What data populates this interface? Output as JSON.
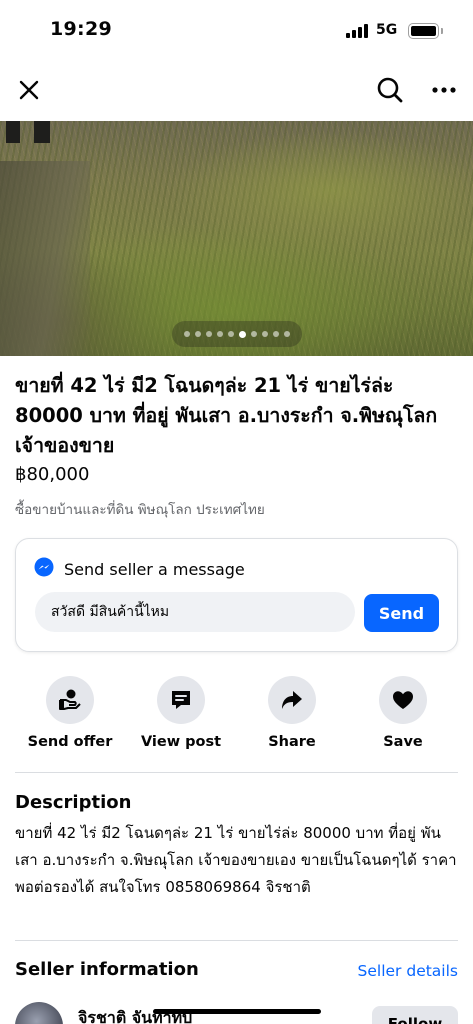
{
  "status_bar": {
    "time": "19:29",
    "network": "5G"
  },
  "listing": {
    "title": "ขายที่ 42 ไร่ มี2 โฉนดๆล่ะ 21 ไร่ ขายไร่ล่ะ 80000 บาท ที่อยู่ พันเสา อ.บางระกำ จ.พิษณุโลก เจ้าของขาย",
    "price": "฿80,000",
    "location": "ซื้อขายบ้านและที่ดิน พิษณุโลก ประเทศไทย",
    "photo_pager": {
      "count": 10,
      "active_index": 5
    }
  },
  "message": {
    "title": "Send seller a message",
    "input_value": "สวัสดี มีสินค้านี้ไหม",
    "send_label": "Send"
  },
  "actions": [
    {
      "label": "Send offer",
      "icon": "offer-icon"
    },
    {
      "label": "View post",
      "icon": "post-icon"
    },
    {
      "label": "Share",
      "icon": "share-icon"
    },
    {
      "label": "Save",
      "icon": "heart-icon"
    }
  ],
  "description": {
    "heading": "Description",
    "text": "ขายที่ 42 ไร่ มี2 โฉนดๆล่ะ 21 ไร่ ขายไร่ล่ะ 80000 บาท ที่อยู่ พันเสา อ.บางระกำ จ.พิษณุโลก เจ้าของขายเอง ขายเป็นโฉนดๆได้ ราคาพอต่อรองได้ สนใจโทร 0858069864 จิรชาติ"
  },
  "seller": {
    "heading": "Seller information",
    "details_link": "Seller details",
    "name": "จิรชาติ จันทาทับ",
    "follow_label": "Follow"
  },
  "colors": {
    "accent": "#0866ff",
    "chip": "#e4e6eb",
    "muted": "#65676b"
  }
}
